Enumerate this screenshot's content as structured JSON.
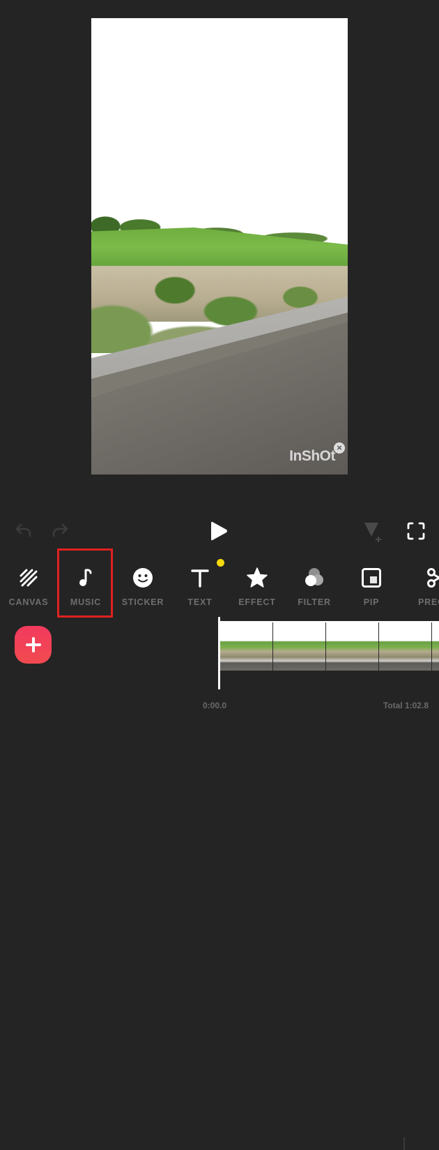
{
  "preview": {
    "watermark": "InShOt",
    "watermark_close": "×"
  },
  "controls": {
    "undo_icon": "undo-icon",
    "redo_icon": "redo-icon",
    "play_icon": "play-icon",
    "keyframe_icon": "keyframe-add-icon",
    "fullscreen_icon": "fullscreen-icon"
  },
  "toolbar": {
    "items": [
      {
        "label": "CANVAS",
        "icon": "canvas-icon"
      },
      {
        "label": "MUSIC",
        "icon": "music-note-icon",
        "highlighted": true
      },
      {
        "label": "STICKER",
        "icon": "smiley-icon"
      },
      {
        "label": "TEXT",
        "icon": "text-icon",
        "badge": "new-dot"
      },
      {
        "label": "EFFECT",
        "icon": "star-icon"
      },
      {
        "label": "FILTER",
        "icon": "filter-circles-icon"
      },
      {
        "label": "PIP",
        "icon": "pip-icon"
      },
      {
        "label": "PREC",
        "icon": "scissors-icon"
      }
    ],
    "highlight_color": "#e02020",
    "badge_color": "#f5d90a"
  },
  "timeline": {
    "add_button_icon": "plus-icon",
    "add_button_color": "#f23a5e",
    "current_time": "0:00.0",
    "total_time": "Total 1:02.8",
    "thumbnail_count": 5
  }
}
